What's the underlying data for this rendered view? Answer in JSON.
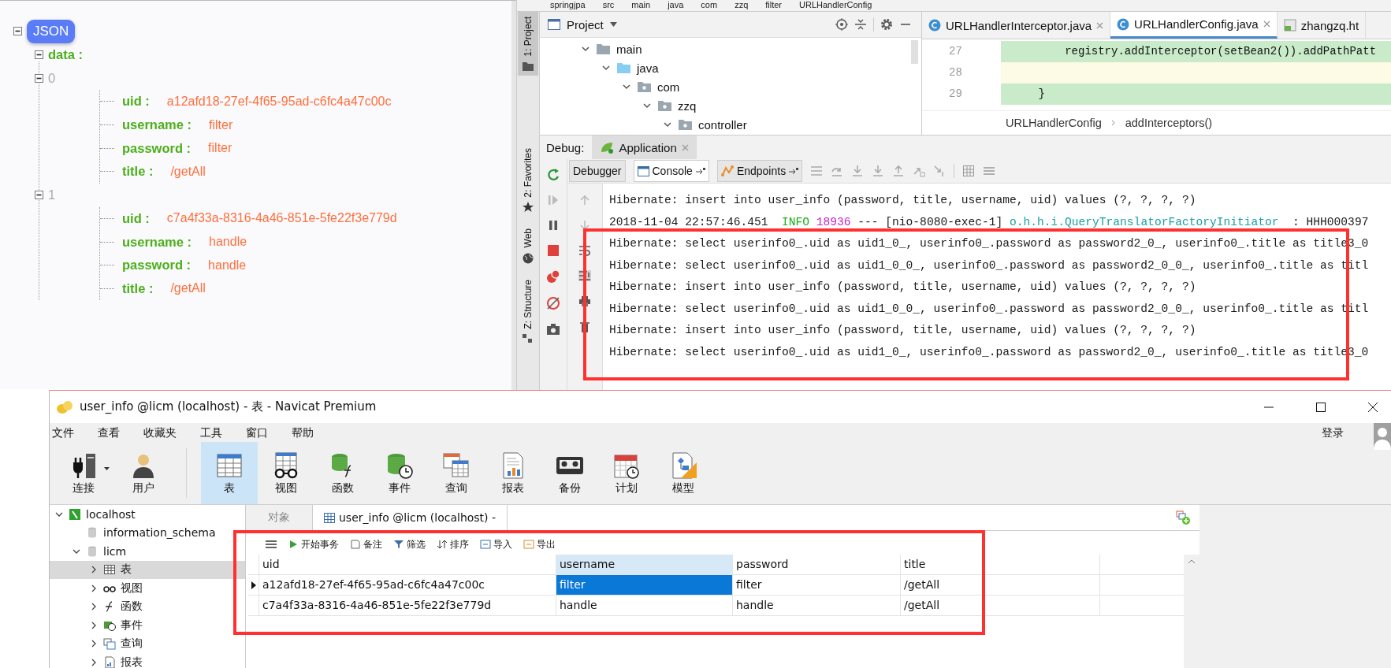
{
  "json_viewer": {
    "root_label": "JSON",
    "key_label": "data :",
    "items": [
      {
        "index": "0",
        "fields": [
          {
            "key": "uid :",
            "value": "a12afd18-27ef-4f65-95ad-c6fc4a47c00c"
          },
          {
            "key": "username :",
            "value": "filter"
          },
          {
            "key": "password :",
            "value": "filter"
          },
          {
            "key": "title :",
            "value": "/getAll"
          }
        ]
      },
      {
        "index": "1",
        "fields": [
          {
            "key": "uid :",
            "value": "c7a4f33a-8316-4a46-851e-5fe22f3e779d"
          },
          {
            "key": "username :",
            "value": "handle"
          },
          {
            "key": "password :",
            "value": "handle"
          },
          {
            "key": "title :",
            "value": "/getAll"
          }
        ]
      }
    ]
  },
  "ide": {
    "breadcrumbs": [
      "springjpa",
      "src",
      "main",
      "java",
      "com",
      "zzq",
      "filter",
      "URLHandlerConfig"
    ],
    "tool_strip": [
      {
        "label": "1: Project",
        "kind": "project",
        "selected": true
      },
      {
        "label": "2: Favorites",
        "kind": "favorites",
        "selected": false
      },
      {
        "label": "Web",
        "kind": "web",
        "selected": false
      },
      {
        "label": "Z: Structure",
        "kind": "structure",
        "selected": false
      }
    ],
    "project": {
      "title": "Project",
      "tree": [
        {
          "label": "main",
          "kind": "folder",
          "expanded": true,
          "children": [
            {
              "label": "java",
              "kind": "source",
              "expanded": true,
              "children": [
                {
                  "label": "com",
                  "kind": "package",
                  "expanded": true,
                  "children": [
                    {
                      "label": "zzq",
                      "kind": "package",
                      "expanded": true,
                      "children": [
                        {
                          "label": "controller",
                          "kind": "package",
                          "expanded": true
                        }
                      ]
                    }
                  ]
                }
              ]
            }
          ]
        }
      ]
    },
    "editor": {
      "tabs": [
        {
          "label": "URLHandlerInterceptor.java",
          "kind": "class",
          "selected": false
        },
        {
          "label": "URLHandlerConfig.java",
          "kind": "class",
          "selected": true
        },
        {
          "label": "zhangzq.ht",
          "kind": "html",
          "selected": false
        }
      ],
      "lines": [
        {
          "number": "27",
          "text": "        registry.addInterceptor(setBean2()).addPathPatt",
          "changed": true,
          "current": false
        },
        {
          "number": "28",
          "changed": false,
          "current": true
        },
        {
          "number": "29",
          "text": "    }",
          "changed": true,
          "current": false
        }
      ],
      "breadcrumbs": [
        "URLHandlerConfig",
        "addInterceptors()"
      ]
    },
    "debug": {
      "label": "Debug:",
      "session": "Application",
      "tabs": [
        {
          "label": "Debugger",
          "kind": "debugger",
          "selected": false
        },
        {
          "label": "Console",
          "kind": "console",
          "selected": true
        },
        {
          "label": "Endpoints",
          "kind": "endpoints",
          "selected": false
        }
      ],
      "console": [
        {
          "segments": [
            {
              "text": "Hibernate: insert into user_info (password, title, username, uid) values (?, ?, ?, ?)",
              "color": "#1a1a1a"
            }
          ]
        },
        {
          "segments": [
            {
              "text": "2018-11-04 22:57:46.451  ",
              "color": "#1a1a1a"
            },
            {
              "text": "INFO ",
              "color": "#16b016"
            },
            {
              "text": "18936",
              "color": "#c81ec8"
            },
            {
              "text": " --- [nio-8080-exec-1] ",
              "color": "#1a1a1a"
            },
            {
              "text": "o.h.h.i.QueryTranslatorFactoryInitiator",
              "color": "#1aa0a8"
            },
            {
              "text": "  : HHH000397",
              "color": "#1a1a1a"
            }
          ]
        },
        {
          "segments": [
            {
              "text": "Hibernate: select userinfo0_.uid as uid1_0_, userinfo0_.password as password2_0_, userinfo0_.title as title3_0",
              "color": "#1a1a1a"
            }
          ]
        },
        {
          "segments": [
            {
              "text": "Hibernate: select userinfo0_.uid as uid1_0_0_, userinfo0_.password as password2_0_0_, userinfo0_.title as titl",
              "color": "#1a1a1a"
            }
          ]
        },
        {
          "segments": [
            {
              "text": "Hibernate: insert into user_info (password, title, username, uid) values (?, ?, ?, ?)",
              "color": "#1a1a1a"
            }
          ]
        },
        {
          "segments": [
            {
              "text": "Hibernate: select userinfo0_.uid as uid1_0_0_, userinfo0_.password as password2_0_0_, userinfo0_.title as titl",
              "color": "#1a1a1a"
            }
          ]
        },
        {
          "segments": [
            {
              "text": "Hibernate: insert into user_info (password, title, username, uid) values (?, ?, ?, ?)",
              "color": "#1a1a1a"
            }
          ]
        },
        {
          "segments": [
            {
              "text": "Hibernate: select userinfo0_.uid as uid1_0_, userinfo0_.password as password2_0_, userinfo0_.title as title3_0",
              "color": "#1a1a1a"
            }
          ]
        }
      ]
    }
  },
  "navicat": {
    "title": "user_info @licm (localhost) - 表 - Navicat Premium",
    "menu": [
      "文件",
      "查看",
      "收藏夹",
      "工具",
      "窗口",
      "帮助"
    ],
    "login": "登录",
    "toolbar": [
      {
        "label": "连接",
        "kind": "connection",
        "selected": false
      },
      {
        "label": "用户",
        "kind": "user",
        "selected": false
      },
      {
        "label": "表",
        "kind": "table",
        "selected": true
      },
      {
        "label": "视图",
        "kind": "view",
        "selected": false
      },
      {
        "label": "函数",
        "kind": "function",
        "selected": false
      },
      {
        "label": "事件",
        "kind": "event",
        "selected": false
      },
      {
        "label": "查询",
        "kind": "query",
        "selected": false
      },
      {
        "label": "报表",
        "kind": "report",
        "selected": false
      },
      {
        "label": "备份",
        "kind": "backup",
        "selected": false
      },
      {
        "label": "计划",
        "kind": "schedule",
        "selected": false
      },
      {
        "label": "模型",
        "kind": "model",
        "selected": false
      }
    ],
    "tree": [
      {
        "label": "localhost",
        "kind": "connection",
        "expanded": true,
        "selected": false,
        "children": [
          {
            "label": "information_schema",
            "kind": "database",
            "selected": false
          },
          {
            "label": "licm",
            "kind": "database",
            "expanded": true,
            "selected": false,
            "children": [
              {
                "label": "表",
                "kind": "table",
                "expanded": false,
                "selected": true
              },
              {
                "label": "视图",
                "kind": "view",
                "expanded": false,
                "selected": false
              },
              {
                "label": "函数",
                "kind": "function",
                "expanded": false,
                "selected": false
              },
              {
                "label": "事件",
                "kind": "event",
                "expanded": false,
                "selected": false
              },
              {
                "label": "查询",
                "kind": "query",
                "expanded": false,
                "selected": false
              },
              {
                "label": "报表",
                "kind": "report",
                "expanded": false,
                "selected": false
              }
            ]
          }
        ]
      }
    ],
    "tabs": [
      {
        "label": "对象",
        "selected": false
      },
      {
        "label": "user_info @licm (localhost) -",
        "selected": true
      }
    ],
    "grid_toolbar": [
      {
        "label": "开始事务",
        "kind": "begin"
      },
      {
        "label": "备注",
        "kind": "note"
      },
      {
        "label": "筛选",
        "kind": "filter"
      },
      {
        "label": "排序",
        "kind": "sort"
      },
      {
        "label": "导入",
        "kind": "import"
      },
      {
        "label": "导出",
        "kind": "export"
      }
    ],
    "table": {
      "columns": [
        {
          "label": "uid",
          "selected": false
        },
        {
          "label": "username",
          "selected": true
        },
        {
          "label": "password",
          "selected": false
        },
        {
          "label": "title",
          "selected": false
        }
      ],
      "rows": [
        {
          "current": true,
          "cells": [
            {
              "text": "a12afd18-27ef-4f65-95ad-c6fc4a47c00c",
              "selected": false
            },
            {
              "text": "filter",
              "selected": true
            },
            {
              "text": "filter",
              "selected": false
            },
            {
              "text": "/getAll",
              "selected": false
            }
          ]
        },
        {
          "current": false,
          "cells": [
            {
              "text": "c7a4f33a-8316-4a46-851e-5fe22f3e779d",
              "selected": false
            },
            {
              "text": "handle",
              "selected": false
            },
            {
              "text": "handle",
              "selected": false
            },
            {
              "text": "/getAll",
              "selected": false
            }
          ]
        }
      ]
    }
  }
}
